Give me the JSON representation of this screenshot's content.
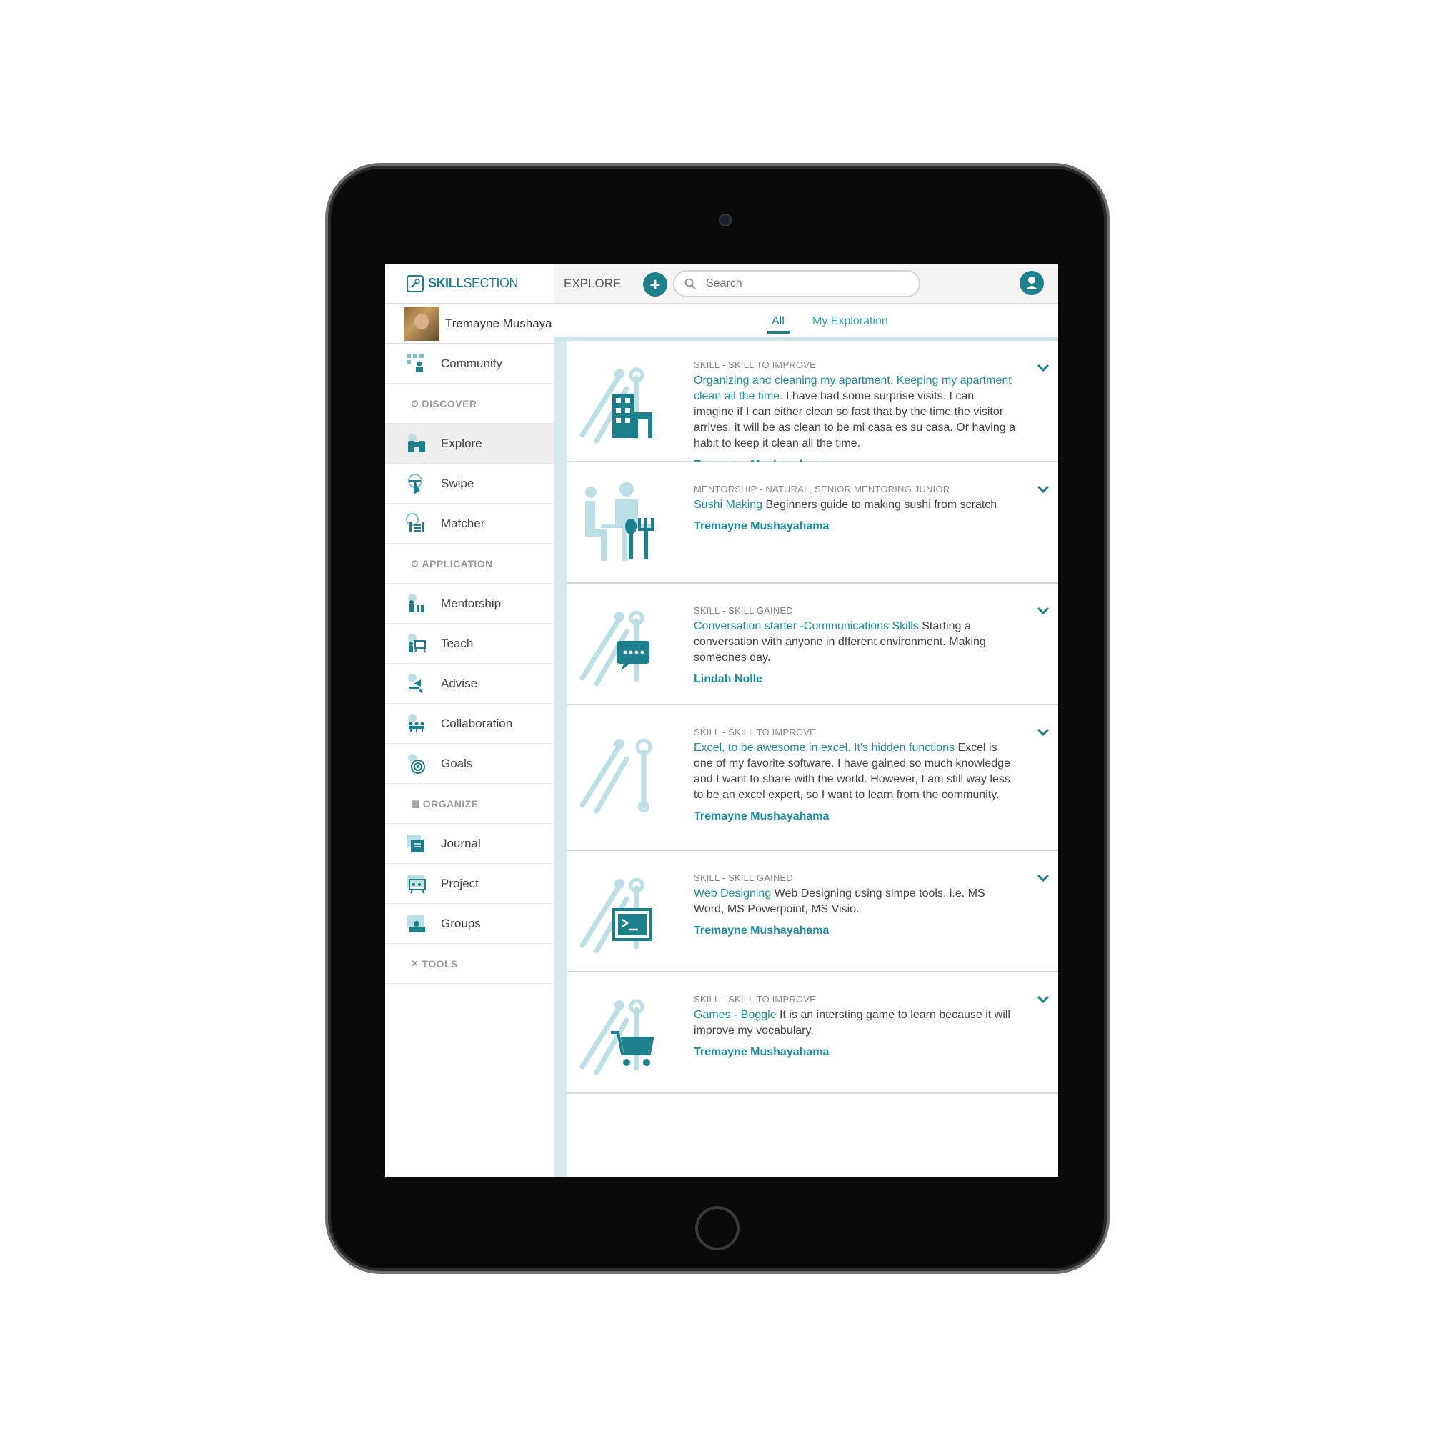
{
  "brand": {
    "part1": "SKILL",
    "part2": "SECTION"
  },
  "user": {
    "name": "Tremayne Mushayahama"
  },
  "sidebar": {
    "community": "Community",
    "sections": {
      "discover": "DISCOVER",
      "application": "APPLICATION",
      "organize": "ORGANIZE",
      "tools": "TOOLS"
    },
    "discover_items": [
      {
        "label": "Explore",
        "icon": "binoculars-icon"
      },
      {
        "label": "Swipe",
        "icon": "swipe-icon"
      },
      {
        "label": "Matcher",
        "icon": "matcher-icon"
      }
    ],
    "application_items": [
      {
        "label": "Mentorship",
        "icon": "mentorship-icon"
      },
      {
        "label": "Teach",
        "icon": "teach-icon"
      },
      {
        "label": "Advise",
        "icon": "advise-icon"
      },
      {
        "label": "Collaboration",
        "icon": "collaboration-icon"
      },
      {
        "label": "Goals",
        "icon": "target-icon"
      }
    ],
    "organize_items": [
      {
        "label": "Journal",
        "icon": "journal-icon"
      },
      {
        "label": "Project",
        "icon": "project-icon"
      },
      {
        "label": "Groups",
        "icon": "groups-icon"
      }
    ]
  },
  "topbar": {
    "title": "EXPLORE",
    "search_placeholder": "Search"
  },
  "tabs": {
    "all": "All",
    "my": "My Exploration",
    "active": "All"
  },
  "cards": [
    {
      "category": "SKILL - SKILL TO IMPROVE",
      "title": "Organizing and cleaning my apartment. Keeping my apartment clean all the time.",
      "text": " I have had some surprise visits. I can imagine if I can either clean so fast that by the time the visitor arrives, it will be as clean to be mi casa es su casa. Or having a habit to keep it clean all the time.",
      "author": "Tremayne Mushayahama",
      "icon": "building-icon"
    },
    {
      "category": "MENTORSHIP - NATURAL, SENIOR MENTORING JUNIOR",
      "title": "Sushi Making",
      "text": " Beginners guide to making sushi from scratch",
      "author": "Tremayne Mushayahama",
      "icon": "dining-icon"
    },
    {
      "category": "SKILL - SKILL GAINED",
      "title": "Conversation starter -Communications Skills",
      "text": " Starting a conversation with anyone in dfferent environment. Making someones day.",
      "author": "Lindah Nolle",
      "icon": "chat-bubble-icon"
    },
    {
      "category": "SKILL - SKILL TO IMPROVE",
      "title": "Excel, to be awesome in excel. It's hidden functions",
      "text": " Excel is one of my favorite software. I have gained so much knowledge and I want to share with the world. However, I am still way less to be an excel expert, so I want to learn from the community.",
      "author": "Tremayne Mushayahama",
      "icon": "tools-icon"
    },
    {
      "category": "SKILL - SKILL GAINED",
      "title": "Web Designing",
      "text": " Web Designing using simpe tools. i.e. MS Word, MS Powerpoint, MS Visio.",
      "author": "Tremayne Mushayahama",
      "icon": "terminal-icon"
    },
    {
      "category": "SKILL - SKILL TO IMPROVE",
      "title": "Games - Boggle",
      "text": " It is an intersting game to learn because it will improve my vocabulary.",
      "author": "Tremayne Mushayahama",
      "icon": "cart-icon"
    }
  ],
  "colors": {
    "accent": "#1b7f8c",
    "link": "#1b8ea0",
    "light_accent": "#bcdfe6"
  }
}
